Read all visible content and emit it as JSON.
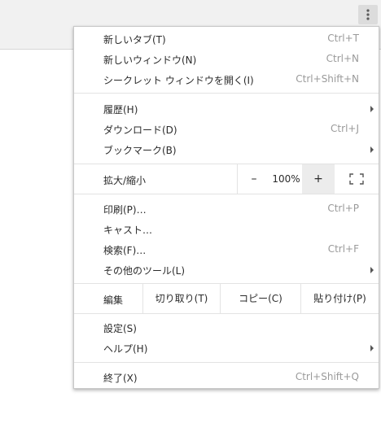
{
  "menu": {
    "items": [
      {
        "label": "新しいタブ(T)",
        "shortcut": "Ctrl+T"
      },
      {
        "label": "新しいウィンドウ(N)",
        "shortcut": "Ctrl+N"
      },
      {
        "label": "シークレット ウィンドウを開く(I)",
        "shortcut": "Ctrl+Shift+N"
      },
      {
        "label": "履歴(H)",
        "shortcut": ""
      },
      {
        "label": "ダウンロード(D)",
        "shortcut": "Ctrl+J"
      },
      {
        "label": "ブックマーク(B)",
        "shortcut": ""
      },
      {
        "label": "印刷(P)…",
        "shortcut": "Ctrl+P"
      },
      {
        "label": "キャスト…",
        "shortcut": ""
      },
      {
        "label": "検索(F)…",
        "shortcut": "Ctrl+F"
      },
      {
        "label": "その他のツール(L)",
        "shortcut": ""
      },
      {
        "label": "設定(S)",
        "shortcut": ""
      },
      {
        "label": "ヘルプ(H)",
        "shortcut": ""
      },
      {
        "label": "終了(X)",
        "shortcut": "Ctrl+Shift+Q"
      }
    ],
    "zoom": {
      "label": "拡大/縮小",
      "minus": "–",
      "value": "100%",
      "plus": "+"
    },
    "edit": {
      "label": "編集",
      "cut": "切り取り(T)",
      "copy": "コピー(C)",
      "paste": "貼り付け(P)"
    }
  }
}
